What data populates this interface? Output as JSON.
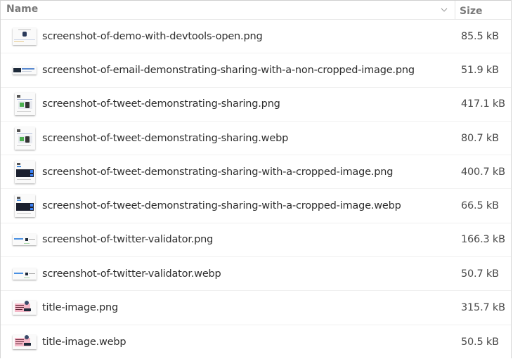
{
  "header": {
    "name_label": "Name",
    "size_label": "Size",
    "sort_icon": "chevron-down-icon"
  },
  "files": [
    {
      "name": "screenshot-of-demo-with-devtools-open.png",
      "size": "85.5 kB",
      "thumb": "devtools"
    },
    {
      "name": "screenshot-of-email-demonstrating-sharing-with-a-non-cropped-image.png",
      "size": "51.9 kB",
      "thumb": "email"
    },
    {
      "name": "screenshot-of-tweet-demonstrating-sharing.png",
      "size": "417.1 kB",
      "thumb": "tweet"
    },
    {
      "name": "screenshot-of-tweet-demonstrating-sharing.webp",
      "size": "80.7 kB",
      "thumb": "tweet"
    },
    {
      "name": "screenshot-of-tweet-demonstrating-sharing-with-a-cropped-image.png",
      "size": "400.7 kB",
      "thumb": "tweet-dark"
    },
    {
      "name": "screenshot-of-tweet-demonstrating-sharing-with-a-cropped-image.webp",
      "size": "66.5 kB",
      "thumb": "tweet-dark"
    },
    {
      "name": "screenshot-of-twitter-validator.png",
      "size": "166.3 kB",
      "thumb": "validator"
    },
    {
      "name": "screenshot-of-twitter-validator.webp",
      "size": "50.7 kB",
      "thumb": "validator"
    },
    {
      "name": "title-image.png",
      "size": "315.7 kB",
      "thumb": "title"
    },
    {
      "name": "title-image.webp",
      "size": "50.5 kB",
      "thumb": "title"
    }
  ]
}
